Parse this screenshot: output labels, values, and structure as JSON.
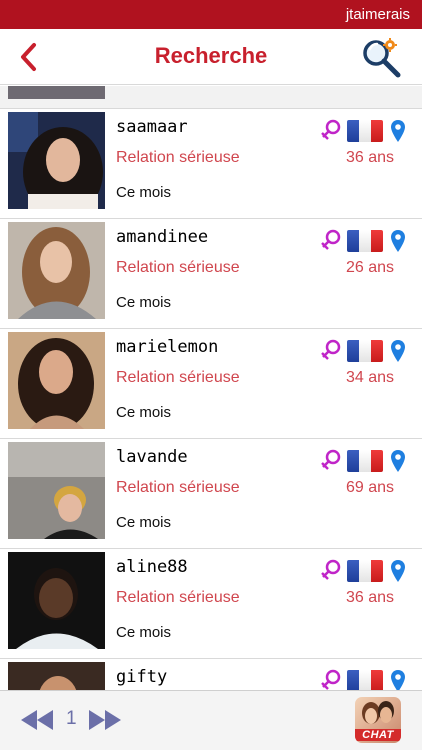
{
  "status_bar": {
    "brand": "jtaimerais"
  },
  "header": {
    "title": "Recherche"
  },
  "profiles": [
    {
      "username": "saamaar",
      "relation": "Relation sérieuse",
      "age": "36 ans",
      "last_seen": "Ce mois"
    },
    {
      "username": "amandinee",
      "relation": "Relation sérieuse",
      "age": "26 ans",
      "last_seen": "Ce mois"
    },
    {
      "username": "marielemon",
      "relation": "Relation sérieuse",
      "age": "34 ans",
      "last_seen": "Ce mois"
    },
    {
      "username": "lavande",
      "relation": "Relation sérieuse",
      "age": "69 ans",
      "last_seen": "Ce mois"
    },
    {
      "username": "aline88",
      "relation": "Relation sérieuse",
      "age": "36 ans",
      "last_seen": "Ce mois"
    },
    {
      "username": "gifty",
      "relation": "",
      "age": "",
      "last_seen": ""
    }
  ],
  "icons": {
    "gender": "female-symbol-icon",
    "country": "france-flag-icon",
    "location": "location-pin-icon"
  },
  "pagination": {
    "current_page": "1"
  },
  "chat": {
    "label": "CHAT"
  },
  "colors": {
    "brand_red": "#b0121f",
    "title_red": "#c8202d",
    "relation_red": "#d0464e",
    "female_pink": "#c025c8",
    "pin_blue": "#1f7fe0",
    "pager_blue": "#6b6fa8"
  }
}
